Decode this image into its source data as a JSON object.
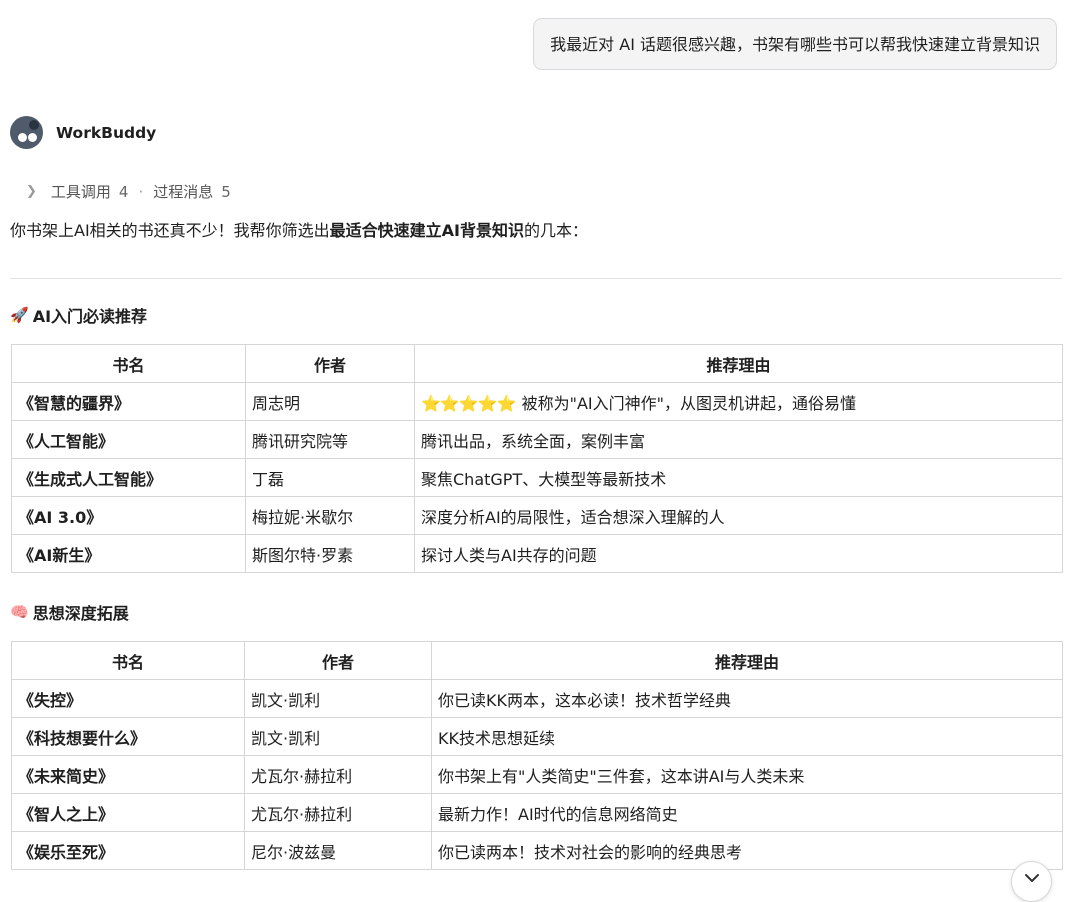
{
  "user_message": "我最近对 AI 话题很感兴趣，书架有哪些书可以帮我快速建立背景知识",
  "agent": {
    "name": "WorkBuddy"
  },
  "process": {
    "tool_calls_label": "工具调用",
    "tool_calls_count": "4",
    "separator": "·",
    "process_messages_label": "过程消息",
    "process_messages_count": "5"
  },
  "intro": {
    "prefix": "你书架上AI相关的书还真不少！我帮你筛选出",
    "bold": "最适合快速建立AI背景知识",
    "suffix": "的几本："
  },
  "section1": {
    "icon": "rocket-icon",
    "icon_glyph": "🚀",
    "title": "AI入门必读推荐",
    "headers": [
      "书名",
      "作者",
      "推荐理由"
    ],
    "rows": [
      {
        "title": "《智慧的疆界》",
        "author": "周志明",
        "stars": "⭐⭐⭐⭐⭐",
        "reason": "被称为\"AI入门神作\"，从图灵机讲起，通俗易懂"
      },
      {
        "title": "《人工智能》",
        "author": "腾讯研究院等",
        "reason": "腾讯出品，系统全面，案例丰富"
      },
      {
        "title": "《生成式人工智能》",
        "author": "丁磊",
        "reason": "聚焦ChatGPT、大模型等最新技术"
      },
      {
        "title": "《AI 3.0》",
        "author": "梅拉妮·米歇尔",
        "reason": "深度分析AI的局限性，适合想深入理解的人"
      },
      {
        "title": "《AI新生》",
        "author": "斯图尔特·罗素",
        "reason": "探讨人类与AI共存的问题"
      }
    ]
  },
  "section2": {
    "icon": "brain-icon",
    "icon_glyph": "🧠",
    "title": "思想深度拓展",
    "headers": [
      "书名",
      "作者",
      "推荐理由"
    ],
    "rows": [
      {
        "title": "《失控》",
        "author": "凯文·凯利",
        "reason": "你已读KK两本，这本必读！技术哲学经典"
      },
      {
        "title": "《科技想要什么》",
        "author": "凯文·凯利",
        "reason": "KK技术思想延续"
      },
      {
        "title": "《未来简史》",
        "author": "尤瓦尔·赫拉利",
        "reason": "你书架上有\"人类简史\"三件套，这本讲AI与人类未来"
      },
      {
        "title": "《智人之上》",
        "author": "尤瓦尔·赫拉利",
        "reason": "最新力作！AI时代的信息网络简史"
      },
      {
        "title": "《娱乐至死》",
        "author": "尼尔·波兹曼",
        "reason": "你已读两本！技术对社会的影响的经典思考"
      }
    ]
  },
  "scroll_button": {
    "icon": "chevron-down-icon"
  }
}
